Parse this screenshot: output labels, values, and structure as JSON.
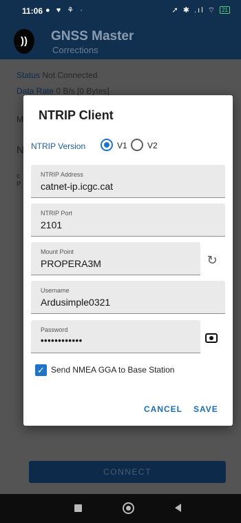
{
  "status_bar": {
    "time": "11:06",
    "left_icons": "● ♥ ⚘ ·",
    "right_icons": "➚ ✱ .ıl ⌔",
    "battery": "21"
  },
  "app": {
    "title": "GNSS Master",
    "subtitle": "Corrections",
    "logo": "))"
  },
  "background": {
    "status_key": "Status",
    "status_value": "Not Connected",
    "data_rate_key": "Data Rate",
    "data_rate_value": "0 B/s [0 Bytes]",
    "partial_m": "M",
    "partial_n": "N",
    "partial_c": "c",
    "partial_p": "P",
    "connect_label": "CONNECT"
  },
  "dialog": {
    "title": "NTRIP Client",
    "version_label": "NTRIP Version",
    "version_options": [
      {
        "label": "V1",
        "selected": true
      },
      {
        "label": "V2",
        "selected": false
      }
    ],
    "fields": {
      "address": {
        "label": "NTRIP Address",
        "value": "catnet-ip.icgc.cat"
      },
      "port": {
        "label": "NTRIP Port",
        "value": "2101"
      },
      "mount_point": {
        "label": "Mount Point",
        "value": "PROPERA3M"
      },
      "username": {
        "label": "Username",
        "value": "Ardusimple0321"
      },
      "password": {
        "label": "Password",
        "value": "••••••••••••"
      }
    },
    "send_gga": {
      "label": "Send NMEA GGA to Base Station",
      "checked": true
    },
    "cancel_label": "CANCEL",
    "save_label": "SAVE"
  },
  "colors": {
    "accent": "#1f73c8",
    "app_bar": "#113050",
    "scrim": "#545454",
    "button_text": "#1c6cb8"
  },
  "icons": {
    "refresh": "refresh-icon",
    "password_visibility": "eye-icon",
    "check": "check-icon"
  }
}
